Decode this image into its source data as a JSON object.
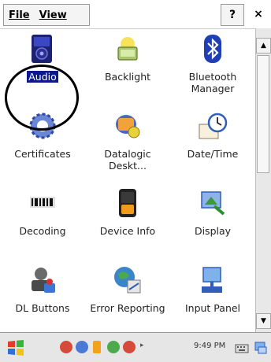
{
  "menu": {
    "file": "File",
    "view": "View"
  },
  "toolbar": {
    "help": "?",
    "close": "×"
  },
  "apps": [
    {
      "label": "Audio",
      "icon": "audio-icon",
      "selected": true
    },
    {
      "label": "Backlight",
      "icon": "backlight-icon"
    },
    {
      "label": "Bluetooth Manager",
      "icon": "bluetooth-icon"
    },
    {
      "label": "Certificates",
      "icon": "certificates-icon"
    },
    {
      "label": "Datalogic Deskt...",
      "icon": "datalogic-desktop-icon"
    },
    {
      "label": "Date/Time",
      "icon": "date-time-icon"
    },
    {
      "label": "Decoding",
      "icon": "decoding-icon"
    },
    {
      "label": "Device Info",
      "icon": "device-info-icon"
    },
    {
      "label": "Display",
      "icon": "display-icon"
    },
    {
      "label": "DL Buttons",
      "icon": "dl-buttons-icon"
    },
    {
      "label": "Error Reporting",
      "icon": "error-reporting-icon"
    },
    {
      "label": "Input Panel",
      "icon": "input-panel-icon"
    }
  ],
  "taskbar": {
    "clock": "9:49 PM"
  },
  "colors": {
    "selection": "#0a1a8c",
    "background": "#ffffff",
    "taskbar": "#e6e6e6"
  }
}
